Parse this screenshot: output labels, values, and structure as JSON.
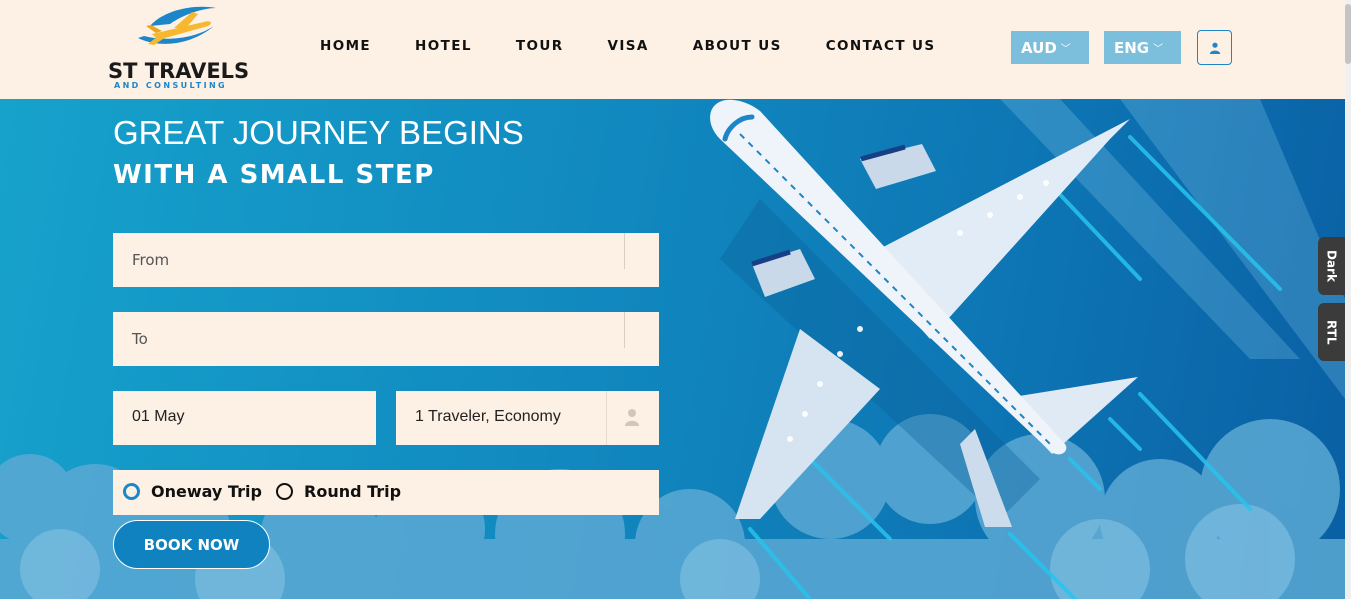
{
  "brand": {
    "name": "ST TRAVELS",
    "tagline": "AND CONSULTING",
    "accent": "#1c86c9",
    "wing_color": "#f5b82e"
  },
  "nav": {
    "items": [
      "HOME",
      "HOTEL",
      "TOUR",
      "VISA",
      "ABOUT US",
      "CONTACT US"
    ]
  },
  "header_controls": {
    "currency": "AUD",
    "language": "ENG",
    "user_icon": "user-icon"
  },
  "hero": {
    "title_line1": "GREAT JOURNEY BEGINS",
    "title_line2": "WITH A SMALL STEP"
  },
  "search_form": {
    "from_placeholder": "From",
    "to_placeholder": "To",
    "date_value": "01 May",
    "travelers_value": "1 Traveler, Economy",
    "trip_options": [
      "Oneway Trip",
      "Round Trip"
    ],
    "selected_trip": "Oneway Trip",
    "submit_label": "BOOK NOW"
  },
  "side_tabs": [
    "Dark",
    "RTL"
  ],
  "colors": {
    "header_bg": "#fdf0e4",
    "hero_blue": "#1188bf",
    "pill_blue": "#7cbfdc"
  }
}
